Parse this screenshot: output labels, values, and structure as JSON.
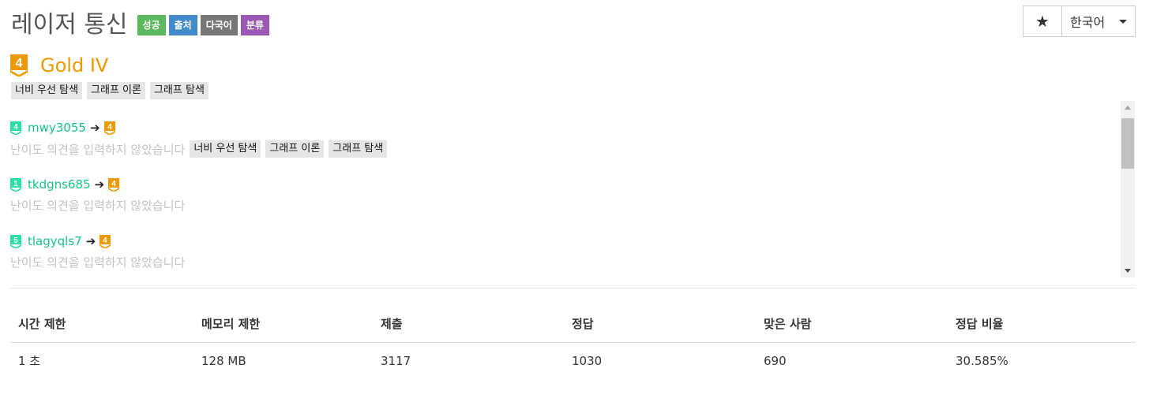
{
  "problem": {
    "title": "레이저 통신",
    "labels": [
      "성공",
      "출처",
      "다국어",
      "분류"
    ]
  },
  "actions": {
    "star_icon": "star-icon",
    "star_glyph": "★",
    "language": "한국어"
  },
  "tier": {
    "badge_number": "4",
    "name": "Gold IV",
    "color": "#ec9a00"
  },
  "tags": [
    "너비 우선 탐색",
    "그래프 이론",
    "그래프 탐색"
  ],
  "opinions": [
    {
      "from_tier": "4",
      "from_color": "#27e2a4",
      "user": "mwy3055",
      "to_tier": "4",
      "text": "난이도 의견을 입력하지 않았습니다",
      "tags": [
        "너비 우선 탐색",
        "그래프 이론",
        "그래프 탐색"
      ]
    },
    {
      "from_tier": "1",
      "from_color": "#27e2a4",
      "user": "tkdgns685",
      "to_tier": "4",
      "text": "난이도 의견을 입력하지 않았습니다",
      "tags": []
    },
    {
      "from_tier": "5",
      "from_color": "#27e2a4",
      "user": "tlagyqls7",
      "to_tier": "4",
      "text": "난이도 의견을 입력하지 않았습니다",
      "tags": []
    }
  ],
  "arrow": "➔",
  "stats": {
    "headers": [
      "시간 제한",
      "메모리 제한",
      "제출",
      "정답",
      "맞은 사람",
      "정답 비율"
    ],
    "values": [
      "1 초",
      "128 MB",
      "3117",
      "1030",
      "690",
      "30.585%"
    ]
  }
}
